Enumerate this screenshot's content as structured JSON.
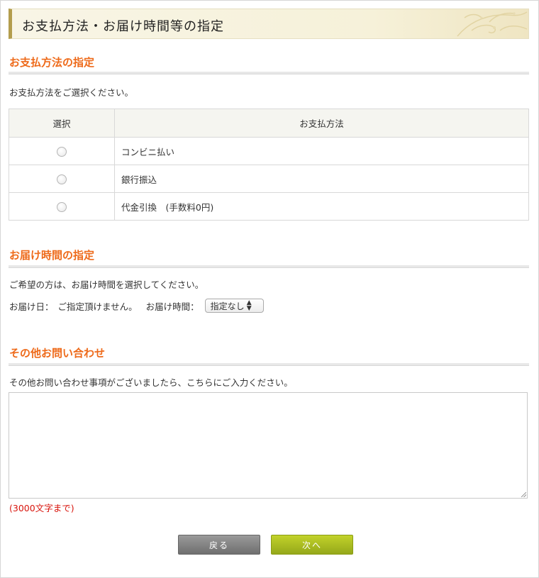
{
  "header": {
    "title": "お支払方法・お届け時間等の指定"
  },
  "payment": {
    "title": "お支払方法の指定",
    "instruction": "お支払方法をご選択ください。",
    "columns": {
      "select": "選択",
      "method": "お支払方法"
    },
    "methods": [
      {
        "label": "コンビニ払い"
      },
      {
        "label": "銀行振込"
      },
      {
        "label": "代金引換　(手数料0円)"
      }
    ]
  },
  "delivery": {
    "title": "お届け時間の指定",
    "instruction": "ご希望の方は、お届け時間を選択してください。",
    "date_label": "お届け日：",
    "date_value": "ご指定頂けません。",
    "time_label": "お届け時間：",
    "time_selected": "指定なし"
  },
  "inquiry": {
    "title": "その他お問い合わせ",
    "instruction": "その他お問い合わせ事項がございましたら、こちらにご入力ください。",
    "message_value": "",
    "limit_note": "(3000文字まで)"
  },
  "buttons": {
    "back": "戻る",
    "next": "次へ"
  },
  "colors": {
    "accent": "#ee6a1a",
    "next_button": "#aabd20",
    "back_button": "#888888",
    "error_text": "#d8140c"
  }
}
